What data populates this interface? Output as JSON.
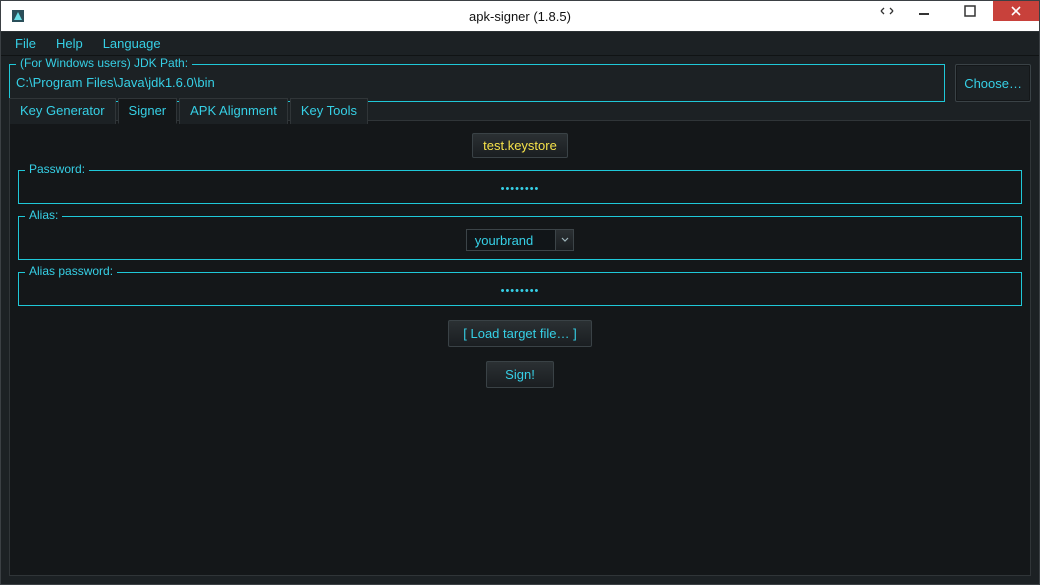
{
  "window": {
    "title": "apk-signer (1.8.5)"
  },
  "menu": {
    "file": "File",
    "help": "Help",
    "language": "Language"
  },
  "jdk": {
    "legend": "(For Windows users) JDK Path:",
    "path": "C:\\Program Files\\Java\\jdk1.6.0\\bin",
    "choose": "Choose…"
  },
  "tabs": {
    "key_generator": "Key Generator",
    "signer": "Signer",
    "apk_alignment": "APK Alignment",
    "key_tools": "Key Tools"
  },
  "signer": {
    "keystore_file": "test.keystore",
    "password_legend": "Password:",
    "password_value": "••••••••",
    "alias_legend": "Alias:",
    "alias_value": "yourbrand",
    "alias_password_legend": "Alias password:",
    "alias_password_value": "••••••••",
    "load_target": "[ Load target file… ]",
    "sign": "Sign!"
  }
}
